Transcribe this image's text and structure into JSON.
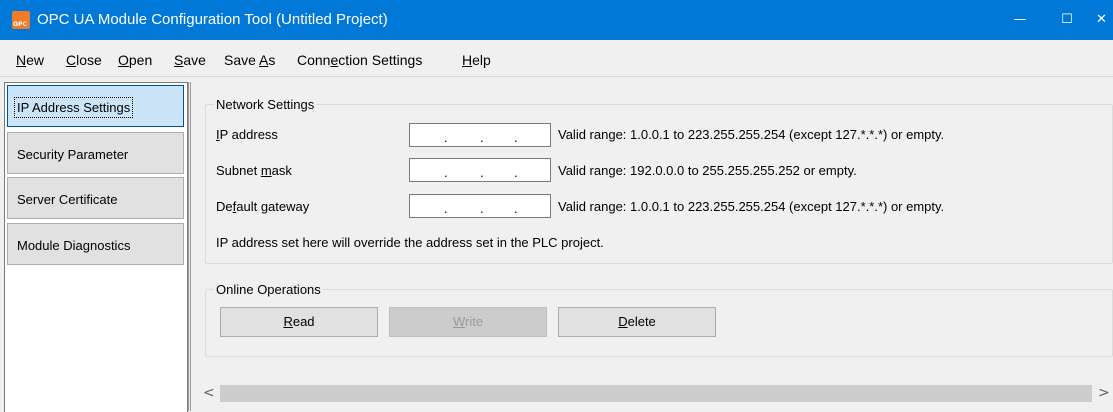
{
  "window": {
    "title": "OPC UA Module Configuration Tool (Untitled Project)",
    "app_icon_text": "OPC",
    "minimize_glyph": "—",
    "maximize_glyph": "☐",
    "close_glyph": "✕"
  },
  "menu": {
    "new": {
      "acc": "N",
      "rest": "ew"
    },
    "close": {
      "acc": "C",
      "rest": "lose"
    },
    "open": {
      "acc": "O",
      "rest": "pen"
    },
    "save": {
      "acc": "S",
      "rest": "ave"
    },
    "save_as": {
      "pre": "Save ",
      "acc": "A",
      "rest": "s"
    },
    "connection_settings": {
      "pre": "Conn",
      "acc": "e",
      "rest": "ction Settings"
    },
    "help": {
      "acc": "H",
      "rest": "elp"
    }
  },
  "sidebar": {
    "items": [
      {
        "label": "IP Address Settings",
        "active": true
      },
      {
        "label": "Security Parameter",
        "active": false
      },
      {
        "label": "Server Certificate",
        "active": false
      },
      {
        "label": "Module Diagnostics",
        "active": false
      }
    ]
  },
  "network_settings": {
    "title": "Network Settings",
    "ip_address": {
      "acc": "I",
      "rest": "P address",
      "hint": "Valid range: 1.0.0.1 to 223.255.255.254 (except 127.*.*.*) or empty."
    },
    "subnet_mask": {
      "pre": "Subnet ",
      "acc": "m",
      "rest": "ask",
      "hint": "Valid range: 192.0.0.0 to 255.255.255.252 or empty."
    },
    "default_gateway": {
      "pre": "De",
      "acc": "f",
      "rest": "ault gateway",
      "hint": "Valid range: 1.0.0.1 to 223.255.255.254 (except 127.*.*.*) or empty."
    },
    "note": "IP address set here will override the address set in the PLC project."
  },
  "online_operations": {
    "title": "Online Operations",
    "read": {
      "acc": "R",
      "rest": "ead"
    },
    "write": {
      "acc": "W",
      "rest": "rite",
      "disabled": true
    },
    "delete": {
      "acc": "D",
      "rest": "elete"
    }
  },
  "scrollbar": {
    "left_glyph": "<",
    "right_glyph": ">"
  }
}
